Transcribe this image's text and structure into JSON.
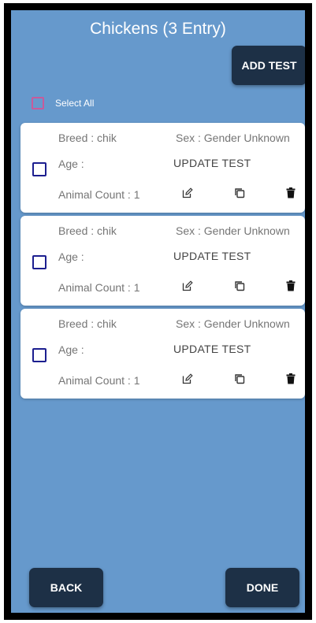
{
  "header": {
    "title": "Chickens (3 Entry)",
    "add_test_label": "ADD TEST"
  },
  "select_all": {
    "label": "Select All"
  },
  "entries": [
    {
      "breed": "Breed : chik",
      "sex": "Sex : Gender Unknown",
      "age": "Age :",
      "update": "UPDATE TEST",
      "count": "Animal Count : 1"
    },
    {
      "breed": "Breed : chik",
      "sex": "Sex : Gender Unknown",
      "age": "Age :",
      "update": "UPDATE TEST",
      "count": "Animal Count : 1"
    },
    {
      "breed": "Breed : chik",
      "sex": "Sex : Gender Unknown",
      "age": "Age :",
      "update": "UPDATE TEST",
      "count": "Animal Count : 1"
    }
  ],
  "footer": {
    "back_label": "BACK",
    "done_label": "DONE"
  },
  "icons": {
    "edit": "edit-icon",
    "copy": "copy-icon",
    "delete": "trash-icon"
  },
  "colors": {
    "background": "#6699cc",
    "button": "#1d3046",
    "checkbox": "#1c1e8f",
    "select_all_checkbox": "#c75b9b"
  }
}
